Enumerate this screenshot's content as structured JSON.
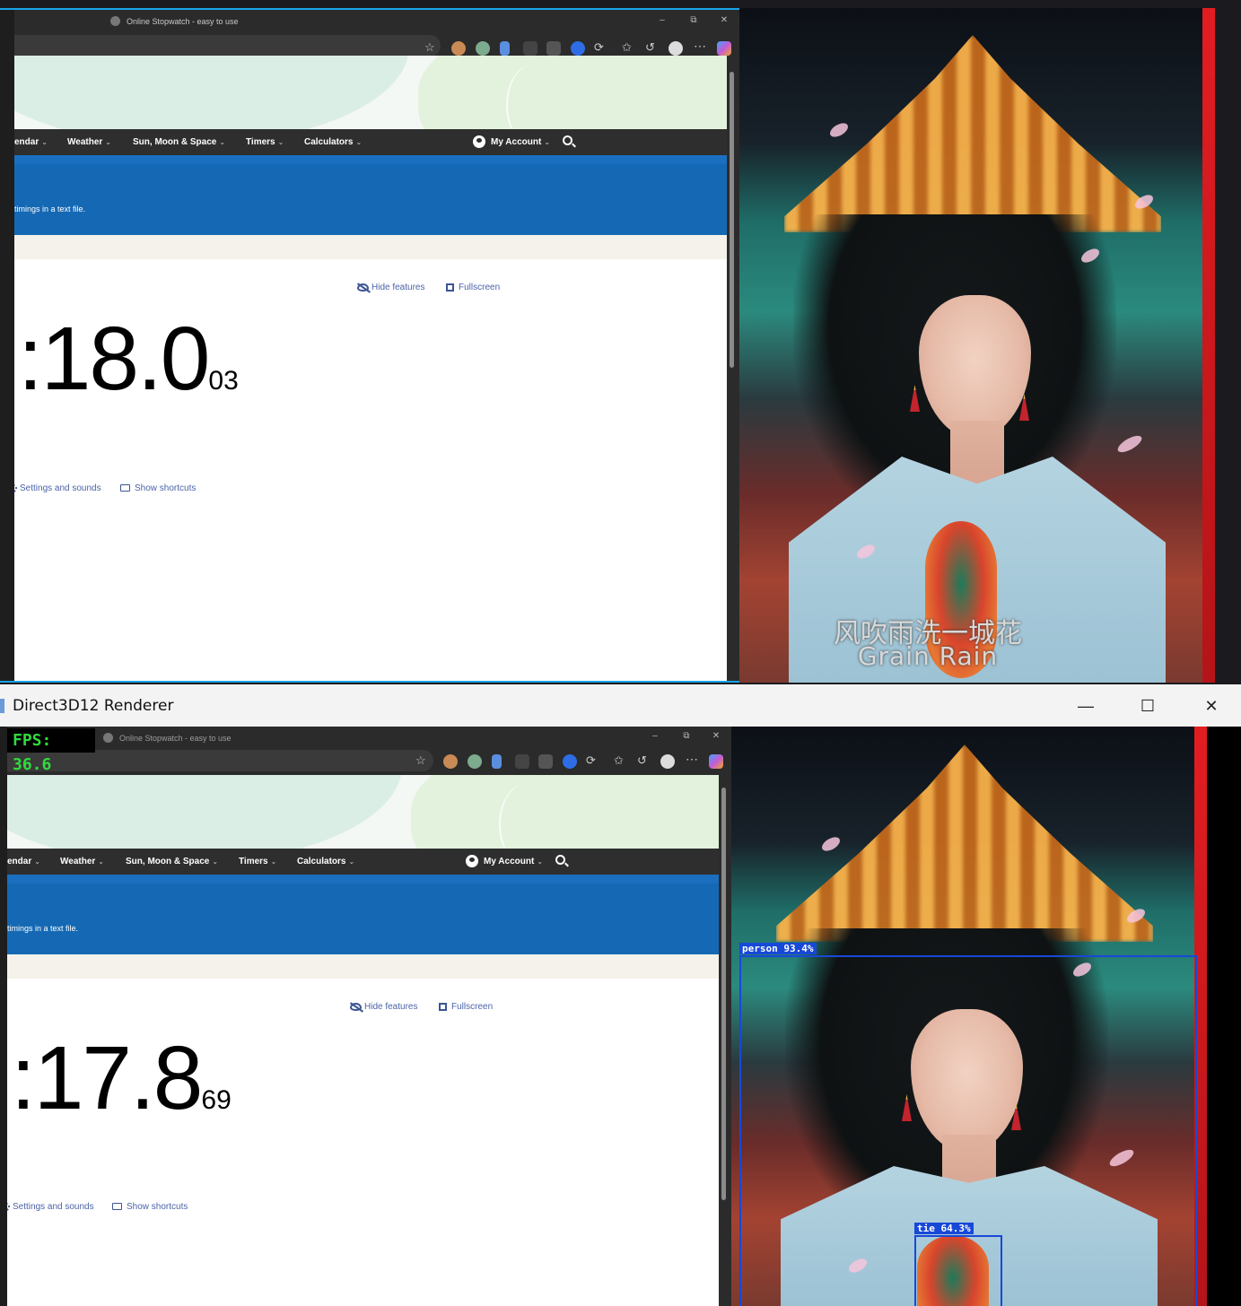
{
  "browser": {
    "title": "Online Stopwatch - easy to use",
    "nav": {
      "items": [
        {
          "label": "endar"
        },
        {
          "label": "Weather"
        },
        {
          "label": "Sun, Moon & Space"
        },
        {
          "label": "Timers"
        },
        {
          "label": "Calculators"
        }
      ],
      "account": "My Account"
    },
    "banner_text": "timings in a text file.",
    "hide_features": "Hide features",
    "fullscreen": "Fullscreen",
    "settings": "Settings and sounds",
    "shortcuts": "Show shortcuts"
  },
  "top_capture": {
    "time_main": ":18.0",
    "time_small": "03"
  },
  "bottom_capture": {
    "time_main": ":17.8",
    "time_small": "69"
  },
  "video": {
    "subtitle_cn": "风吹雨洗一城花",
    "subtitle_en": "Grain Rain"
  },
  "renderer": {
    "title": "Direct3D12 Renderer",
    "fps_label": "FPS:",
    "fps_value": "36.6",
    "detections": [
      {
        "label": "person",
        "confidence": "93.4%"
      },
      {
        "label": "tie",
        "confidence": "64.3%"
      }
    ]
  },
  "colors": {
    "accent_selection": "#1aa3e8",
    "banner_blue": "#1569b4",
    "navbar": "#2e2e2e",
    "detection_blue": "#1848d8",
    "fps_green": "#2fdc3c"
  }
}
